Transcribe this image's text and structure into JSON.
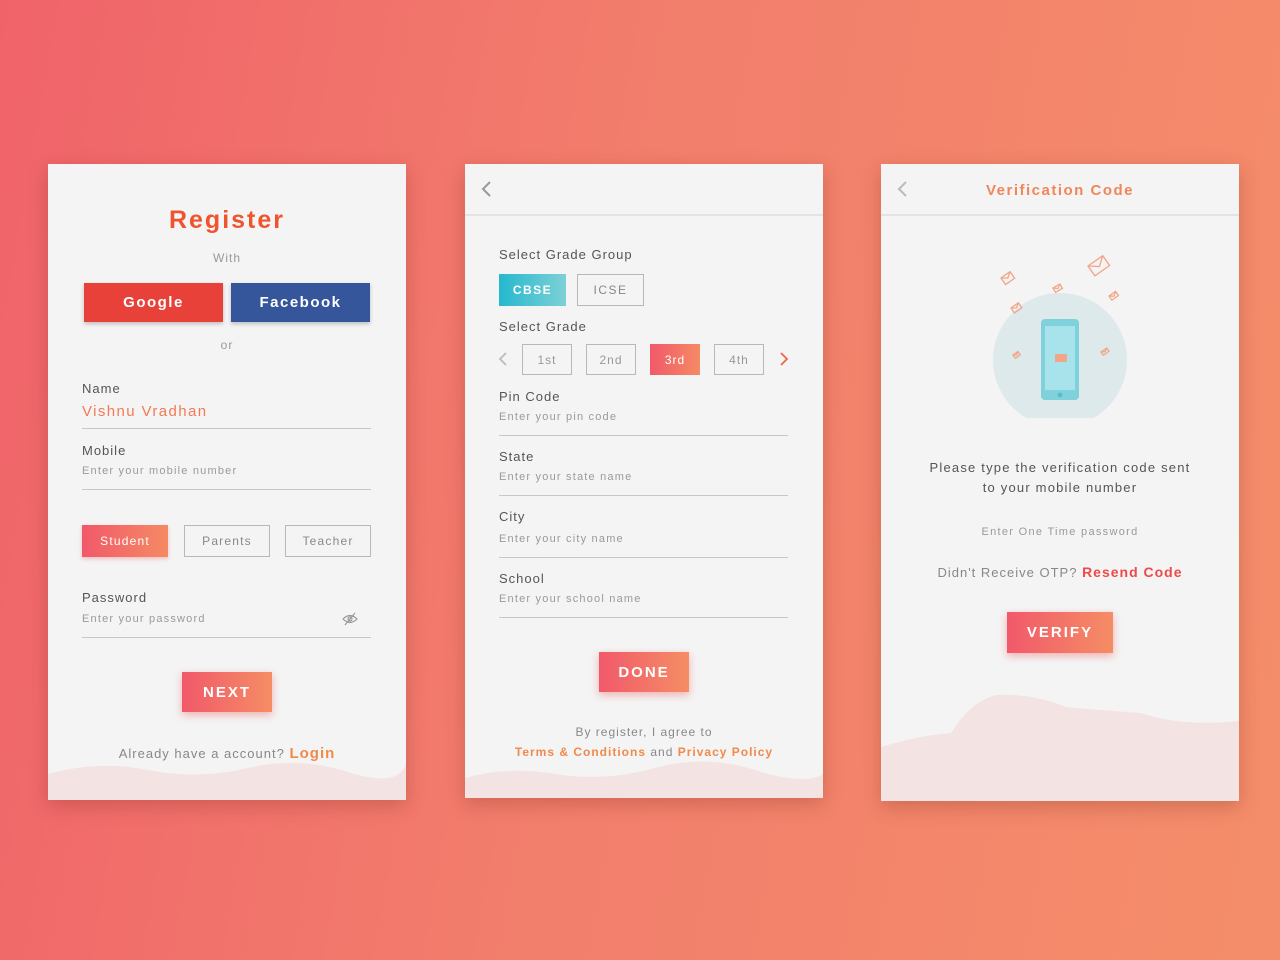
{
  "register_screen": {
    "title": "Register",
    "with_label": "With",
    "google_label": "Google",
    "facebook_label": "Facebook",
    "or_label": "or",
    "name_label": "Name",
    "name_value": "Vishnu Vradhan",
    "mobile_label": "Mobile",
    "mobile_placeholder": "Enter your mobile number",
    "roles": [
      "Student",
      "Parents",
      "Teacher"
    ],
    "selected_role": "Student",
    "password_label": "Password",
    "password_placeholder": "Enter your password",
    "next_label": "NEXT",
    "login_prompt": "Already have a account?",
    "login_link": "Login"
  },
  "details_screen": {
    "grade_group_label": "Select Grade Group",
    "grade_groups": [
      "CBSE",
      "ICSE"
    ],
    "selected_group": "CBSE",
    "grade_label": "Select Grade",
    "grades": [
      "1st",
      "2nd",
      "3rd",
      "4th"
    ],
    "selected_grade": "3rd",
    "pin_label": "Pin Code",
    "pin_placeholder": "Enter your pin code",
    "state_label": "State",
    "state_placeholder": "Enter your state name",
    "city_label": "City",
    "city_placeholder": "Enter your city name",
    "school_label": "School",
    "school_placeholder": "Enter your school name",
    "done_label": "DONE",
    "agree_text": "By register, I agree to",
    "terms_link": "Terms & Conditions",
    "and_text": "and",
    "privacy_link": "Privacy Policy"
  },
  "verify_screen": {
    "title": "Verification Code",
    "message_line1": "Please type the verification code sent",
    "message_line2": "to your mobile number",
    "otp_placeholder": "Enter One Time password",
    "resend_prompt": "Didn't Receive OTP?",
    "resend_link": "Resend Code",
    "verify_label": "VERIFY"
  },
  "colors": {
    "accent_orange": "#f0542f",
    "google_red": "#e8413a",
    "facebook_blue": "#35569a",
    "teal": "#25b8cf",
    "gradient_start": "#f1596a",
    "gradient_end": "#f58d65"
  },
  "icons": [
    "back-arrow-icon",
    "chevron-left-icon",
    "chevron-right-icon",
    "eye-off-icon",
    "phone-icon",
    "envelope-icon"
  ]
}
